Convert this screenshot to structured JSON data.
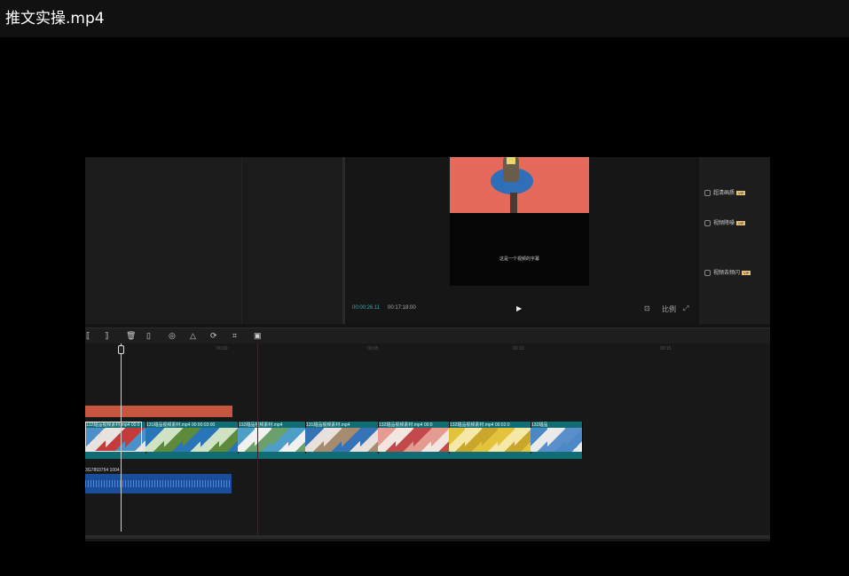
{
  "window": {
    "title": "推文实操.mp4"
  },
  "preview": {
    "subtitle": "这是一个视频的字幕",
    "current_time": "00:00:26.11",
    "total_time": "00:17:18:00",
    "play_icon": "play-icon",
    "ratio_label": "比例"
  },
  "options": [
    {
      "label": "超清画质",
      "badge": "VIP"
    },
    {
      "label": "视频降噪",
      "badge": "VIP"
    },
    {
      "label": "视频去频闪",
      "badge": "VIP"
    }
  ],
  "toolbar_icons": [
    "split-left-icon",
    "split-right-icon",
    "delete-icon",
    "freeze-icon",
    "speed-icon",
    "mirror-icon",
    "rotate-icon",
    "crop-icon",
    "cover-icon"
  ],
  "timeline": {
    "ruler": [
      "00:00",
      "00:05",
      "00:10",
      "00:15"
    ],
    "clips": [
      {
        "label": "132甜品视频素材.mp4  00:0",
        "colors": [
          "#4d8fc9",
          "#e9e3df",
          "#c43b3b"
        ]
      },
      {
        "label": "131甜品视频素材.mp4  00:00:03:00",
        "colors": [
          "#2a75b8",
          "#cfe2c4",
          "#5e8a3c"
        ]
      },
      {
        "label": "132甜品视频素材.mp4",
        "colors": [
          "#4f9ec8",
          "#f1f1f1",
          "#6ba06a"
        ]
      },
      {
        "label": "131甜品视频素材.mp4",
        "colors": [
          "#3573b6",
          "#e7e0dc",
          "#a68b6e"
        ]
      },
      {
        "label": "132甜品视频素材.mp4  00:0",
        "colors": [
          "#e59a92",
          "#f3e6e0",
          "#c34a4a"
        ]
      },
      {
        "label": "132甜品视频素材.mp4  00:02:0",
        "colors": [
          "#e3c23c",
          "#f6e9a8",
          "#caa62c"
        ]
      },
      {
        "label": "132甜品",
        "colors": [
          "#4c88c6",
          "#eaeaea",
          "#5a8fcb"
        ]
      }
    ],
    "audio_label": "3G7893754 1004"
  }
}
